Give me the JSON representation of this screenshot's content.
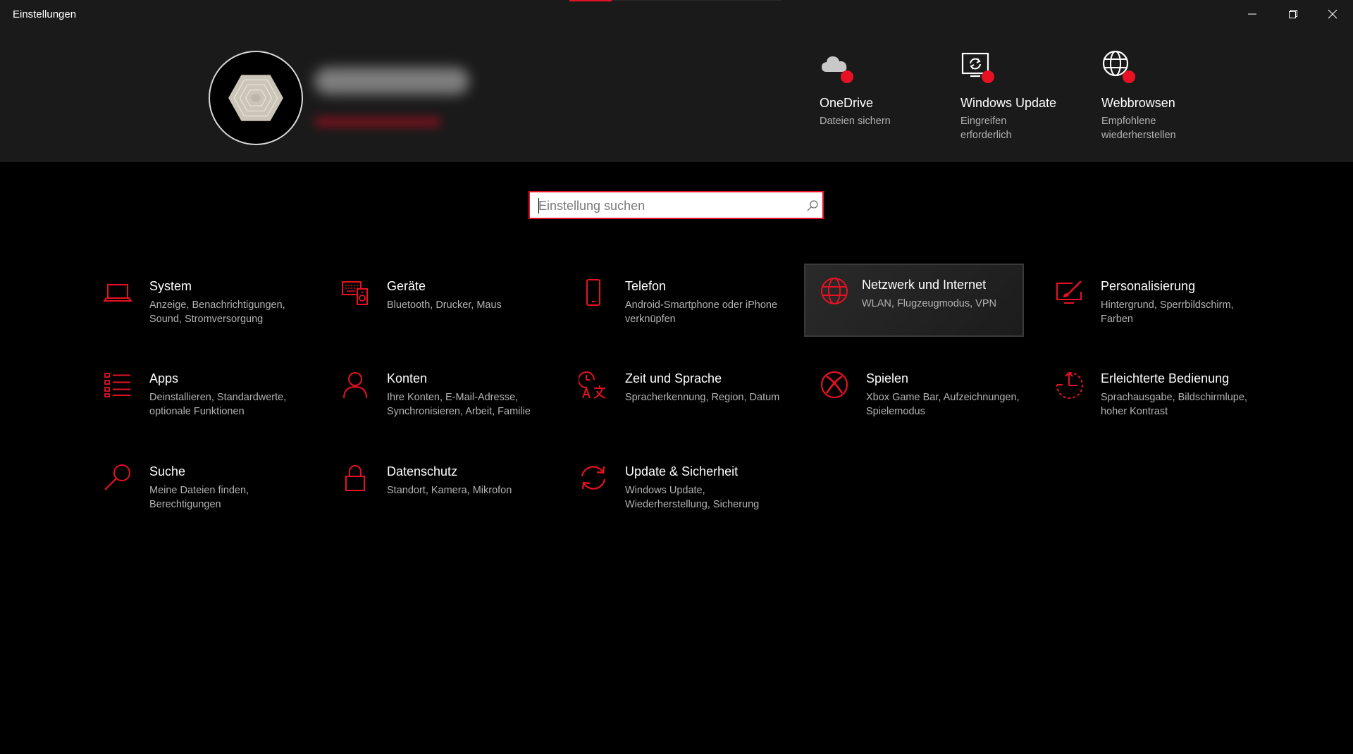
{
  "window": {
    "title": "Einstellungen"
  },
  "colors": {
    "accent": "#e81123",
    "background": "#000000",
    "header_bg": "#1a1a1a",
    "subtext": "#b3b3b3"
  },
  "header": {
    "quick_links": [
      {
        "icon": "onedrive-cloud-icon",
        "title": "OneDrive",
        "subtitle": "Dateien sichern"
      },
      {
        "icon": "windows-update-icon",
        "title": "Windows Update",
        "subtitle": "Eingreifen erforderlich"
      },
      {
        "icon": "web-browse-globe-icon",
        "title": "Webbrowsen",
        "subtitle": "Empfohlene wiederherstellen"
      }
    ]
  },
  "search": {
    "placeholder": "Einstellung suchen",
    "value": ""
  },
  "categories": [
    {
      "icon": "laptop-icon",
      "name": "System",
      "desc": "Anzeige, Benachrichtigungen, Sound, Stromversorgung"
    },
    {
      "icon": "devices-icon",
      "name": "Geräte",
      "desc": "Bluetooth, Drucker, Maus"
    },
    {
      "icon": "phone-icon",
      "name": "Telefon",
      "desc": "Android-Smartphone oder iPhone verknüpfen"
    },
    {
      "icon": "globe-icon",
      "name": "Netzwerk und Internet",
      "desc": "WLAN, Flugzeugmodus, VPN"
    },
    {
      "icon": "personalization-icon",
      "name": "Personalisierung",
      "desc": "Hintergrund, Sperrbildschirm, Farben"
    },
    {
      "icon": "apps-list-icon",
      "name": "Apps",
      "desc": "Deinstallieren, Standardwerte, optionale Funktionen"
    },
    {
      "icon": "person-icon",
      "name": "Konten",
      "desc": "Ihre Konten, E-Mail-Adresse, Synchronisieren, Arbeit, Familie"
    },
    {
      "icon": "time-language-icon",
      "name": "Zeit und Sprache",
      "desc": "Spracherkennung, Region, Datum"
    },
    {
      "icon": "xbox-icon",
      "name": "Spielen",
      "desc": "Xbox Game Bar, Aufzeichnungen, Spielemodus"
    },
    {
      "icon": "ease-of-access-icon",
      "name": "Erleichterte Bedienung",
      "desc": "Sprachausgabe, Bildschirmlupe, hoher Kontrast"
    },
    {
      "icon": "search-magnifier-icon",
      "name": "Suche",
      "desc": "Meine Dateien finden, Berechtigungen"
    },
    {
      "icon": "lock-icon",
      "name": "Datenschutz",
      "desc": "Standort, Kamera, Mikrofon"
    },
    {
      "icon": "update-sync-icon",
      "name": "Update & Sicherheit",
      "desc": "Windows Update, Wiederherstellung, Sicherung"
    }
  ]
}
